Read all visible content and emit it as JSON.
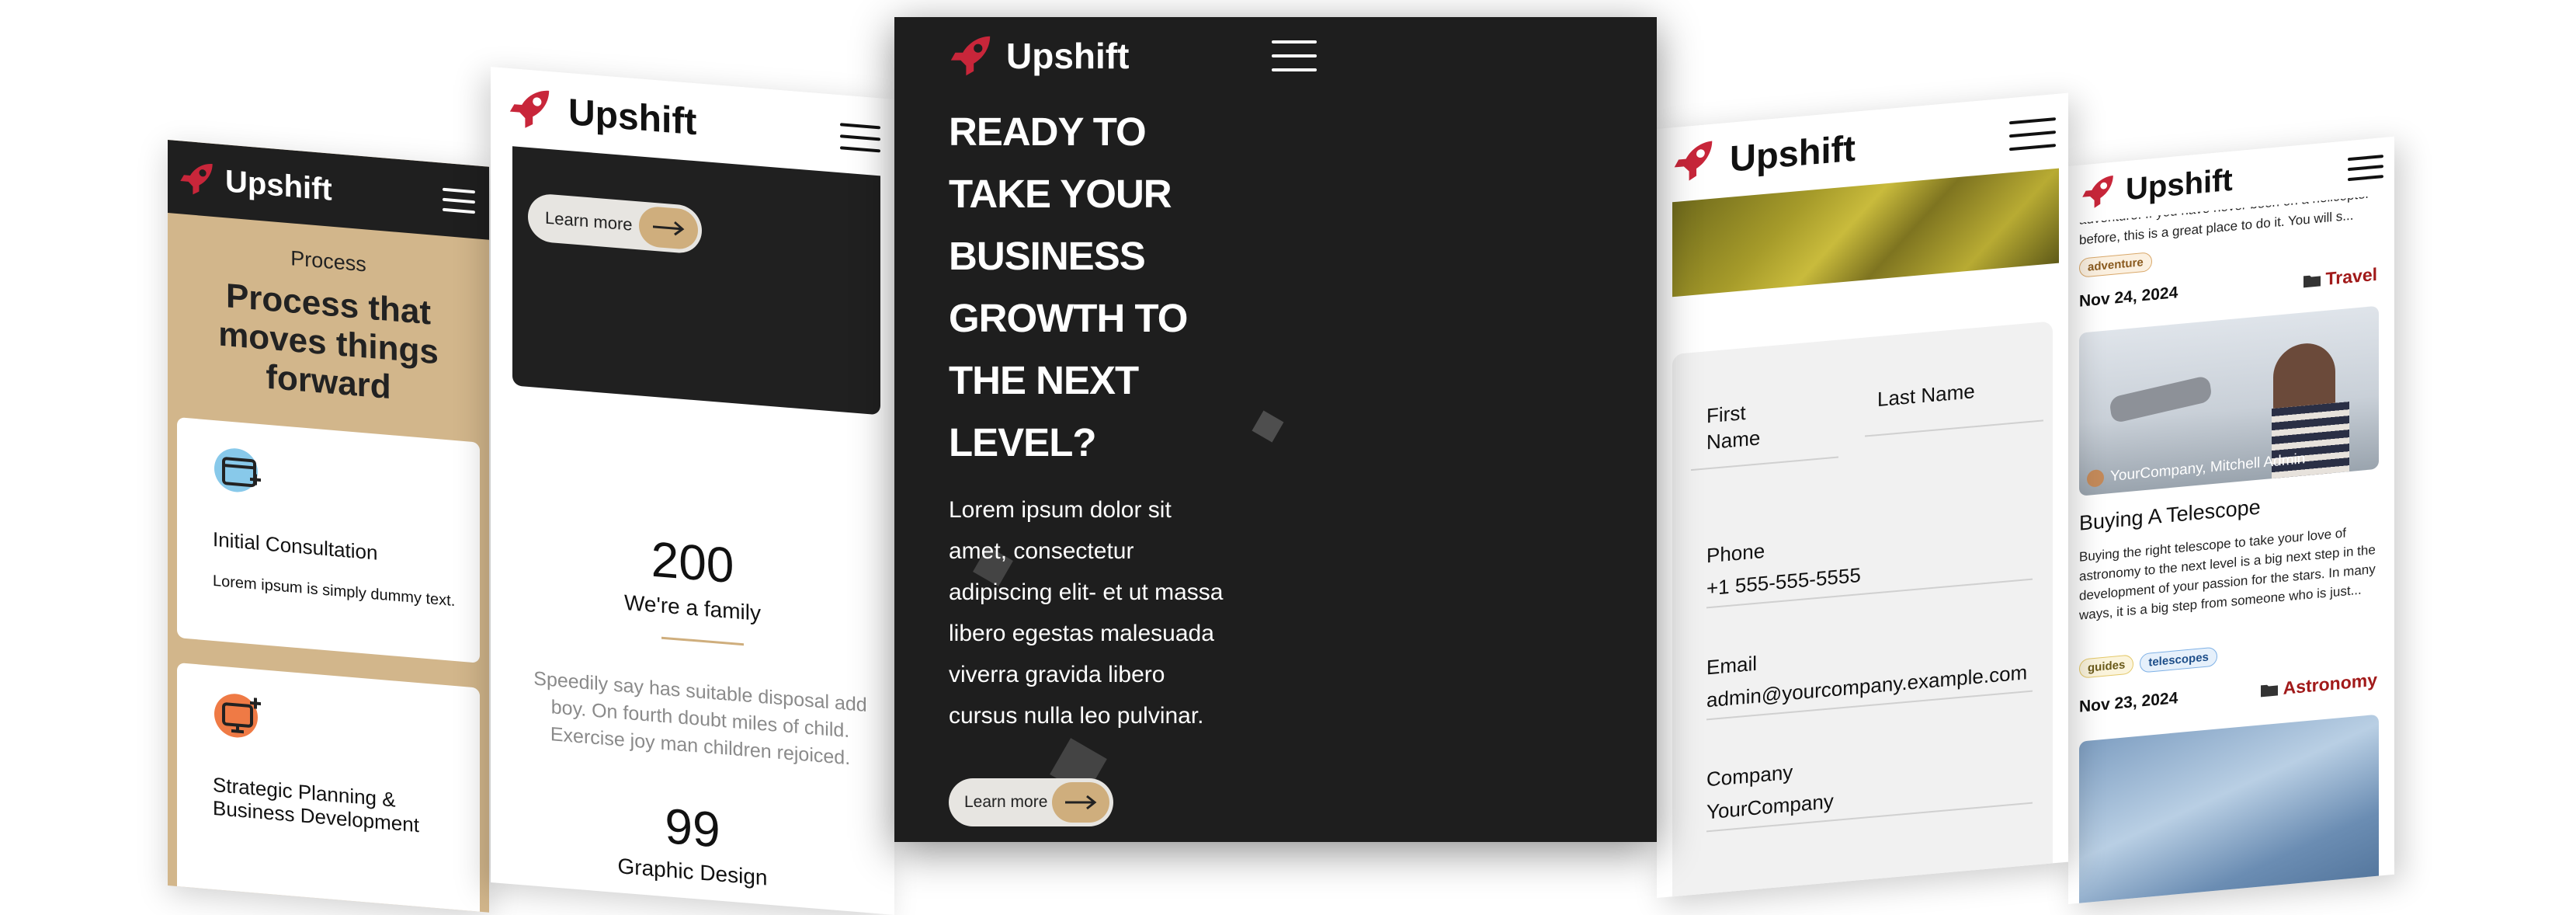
{
  "brand": {
    "name": "Upshift",
    "accent": "#c8263a",
    "dark": "#1e1e1e",
    "tan": "#d2b68b"
  },
  "screen1": {
    "section_label": "Process",
    "heading": "Process that moves things forward",
    "cards": [
      {
        "title": "Initial Consultation",
        "text": "Lorem ipsum is simply dummy text."
      },
      {
        "title": "Strategic Planning & Business Development"
      }
    ]
  },
  "screen2": {
    "learn_more": "Learn more",
    "stat1_value": "200",
    "stat1_label": "We're a family",
    "paragraph": "Speedily say has suitable disposal add boy. On fourth doubt miles of child. Exercise joy man children rejoiced.",
    "stat2_value": "99",
    "stat2_label": "Graphic Design"
  },
  "screen3": {
    "hero_title": "READY TO TAKE YOUR BUSINESS GROWTH TO THE NEXT LEVEL?",
    "hero_text": "Lorem ipsum dolor sit amet, consectetur adipiscing elit- et ut massa libero egestas malesuada viverra gravida libero cursus nulla leo pulvinar.",
    "learn_more": "Learn more"
  },
  "screen4": {
    "first_name_label": "First Name",
    "last_name_label": "Last Name",
    "phone_label": "Phone",
    "phone_value": "+1 555-555-5555",
    "email_label": "Email",
    "email_value": "admin@yourcompany.example.com",
    "company_label": "Company",
    "company_value": "YourCompany"
  },
  "screen5": {
    "snippet": "adventure. If you have never been on a helicopter before, this is a great place to do it. You will s...",
    "post1": {
      "tag": "adventure",
      "date": "Nov 24, 2024",
      "category": "Travel"
    },
    "post2": {
      "author": "YourCompany, Mitchell Admin",
      "title": "Buying A Telescope",
      "text": "Buying the right telescope to take your love of astronomy to the next level is a big next step in the development of your passion for the stars. In many ways, it is a big step from someone who is just...",
      "tags": [
        "guides",
        "telescopes"
      ],
      "date": "Nov 23, 2024",
      "category": "Astronomy"
    }
  }
}
